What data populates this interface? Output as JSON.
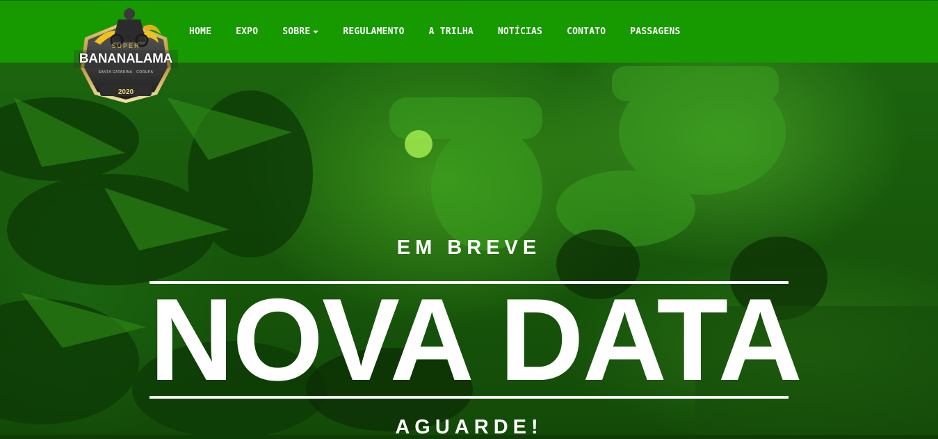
{
  "brand": {
    "logo_top": "SUPER",
    "logo_name": "BANANALAMA",
    "logo_sub": "SANTA CATARINA · CORUPÁ",
    "logo_year": "2020"
  },
  "nav": {
    "items": [
      {
        "label": "HOME"
      },
      {
        "label": "EXPO"
      },
      {
        "label": "SOBRE"
      },
      {
        "label": "REGULAMENTO"
      },
      {
        "label": "A TRILHA"
      },
      {
        "label": "NOTÍCIAS"
      },
      {
        "label": "CONTATO"
      },
      {
        "label": "PASSAGENS"
      }
    ]
  },
  "hero": {
    "kicker": "EM BREVE",
    "headline": "NOVA DATA",
    "footer": "AGUARDE!"
  },
  "colors": {
    "navbar": "#169a00",
    "hero_tint": "#1e6a10",
    "text": "#ffffff"
  }
}
